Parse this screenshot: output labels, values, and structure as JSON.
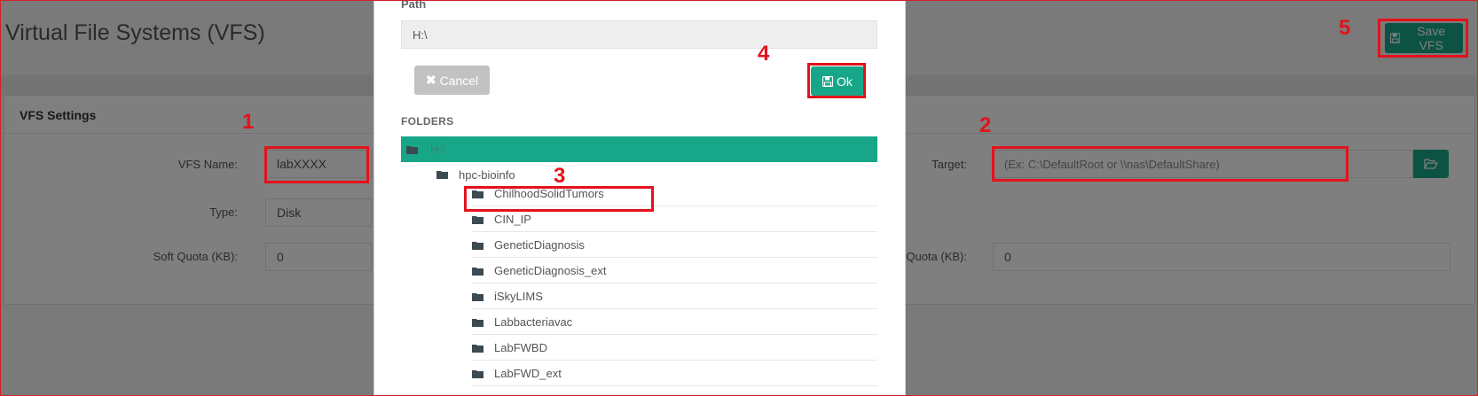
{
  "page": {
    "title": "Virtual File Systems (VFS)",
    "save_button": "Save VFS"
  },
  "settings": {
    "header": "VFS Settings",
    "vfs_name_label": "VFS Name:",
    "vfs_name_value": "labXXXX",
    "type_label": "Type:",
    "type_value": "Disk",
    "soft_quota_label": "Soft Quota (KB):",
    "soft_quota_value": "0",
    "target_label": "Target:",
    "target_placeholder": "(Ex: C:\\DefaultRoot or \\\\nas\\DefaultShare)",
    "hard_quota_label_partial": "Quota (KB):",
    "hard_quota_value": "0"
  },
  "modal": {
    "path_label": "Path",
    "path_value": "H:\\",
    "cancel_label": "Cancel",
    "ok_label": "Ok",
    "folders_label": "FOLDERS",
    "root": "H:\\",
    "level1": "hpc-bioinfo",
    "folders": [
      "ChilhoodSolidTumors",
      "CIN_IP",
      "GeneticDiagnosis",
      "GeneticDiagnosis_ext",
      "iSkyLIMS",
      "Labbacteriavac",
      "LabFWBD",
      "LabFWD_ext"
    ]
  },
  "annotations": [
    "1",
    "2",
    "3",
    "4",
    "5"
  ],
  "colors": {
    "accent": "#18a689",
    "annotation": "#e3121b",
    "cancel": "#c2c2c2"
  }
}
